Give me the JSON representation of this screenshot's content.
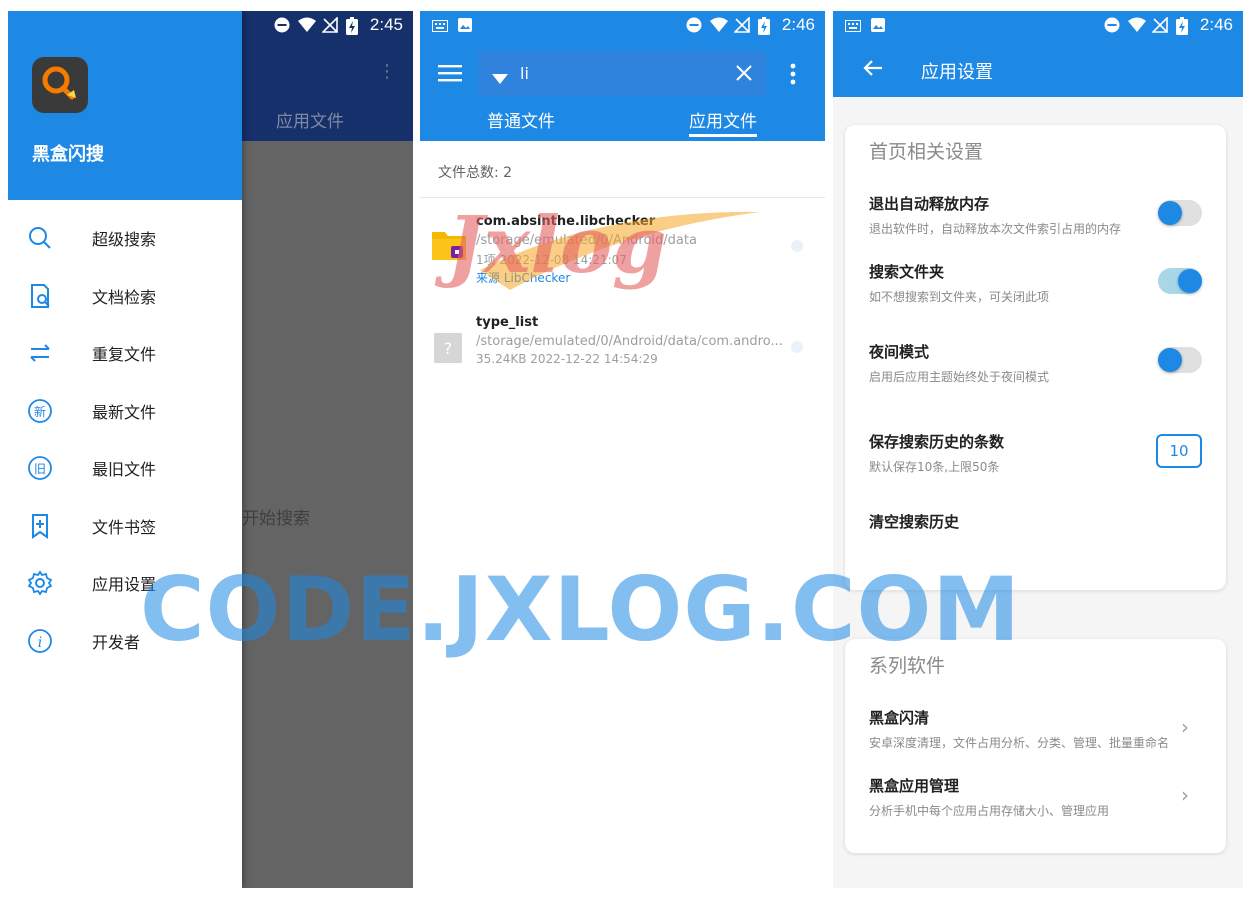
{
  "colors": {
    "primary": "#1e88e5",
    "dim": "#646464",
    "watermark_text": "#1e88e5",
    "watermark_logo": "#e46363",
    "swoosh": "#f5a623"
  },
  "status": {
    "time1": "2:45",
    "time2": "2:46",
    "time3": "2:46"
  },
  "drawer": {
    "app_name": "黑盒闪搜",
    "items": [
      {
        "label": "超级搜索",
        "icon": "search-icon"
      },
      {
        "label": "文档检索",
        "icon": "document-search-icon"
      },
      {
        "label": "重复文件",
        "icon": "repeat-icon"
      },
      {
        "label": "最新文件",
        "icon": "new-badge-icon"
      },
      {
        "label": "最旧文件",
        "icon": "old-badge-icon"
      },
      {
        "label": "文件书签",
        "icon": "bookmark-add-icon"
      },
      {
        "label": "应用设置",
        "icon": "gear-icon"
      },
      {
        "label": "开发者",
        "icon": "info-icon"
      }
    ],
    "behind_tab": "应用文件",
    "behind_hint": "开始搜索"
  },
  "files_screen": {
    "search_query": "li",
    "tabs": [
      "普通文件",
      "应用文件"
    ],
    "active_tab": 1,
    "count_label": "文件总数: 2",
    "files": [
      {
        "name": "com.absinthe.libchecker",
        "path": "/storage/emulated/0/Android/data",
        "meta": "1项  2022-12-08 14:21:07",
        "source": "来源  LibChecker",
        "icon": "folder-icon"
      },
      {
        "name": "type_list",
        "path": "/storage/emulated/0/Android/data/com.andro...",
        "meta": "35.24KB  2022-12-22 14:54:29",
        "source": "",
        "icon": "unknown-file-icon"
      }
    ]
  },
  "settings": {
    "title": "应用设置",
    "section1_title": "首页相关设置",
    "items": [
      {
        "title": "退出自动释放内存",
        "desc": "退出软件时，自动释放本次文件索引占用的内存",
        "toggle": false
      },
      {
        "title": "搜索文件夹",
        "desc": "如不想搜索到文件夹，可关闭此项",
        "toggle": true
      },
      {
        "title": "夜间模式",
        "desc": "启用后应用主题始终处于夜间模式",
        "toggle": false
      }
    ],
    "history_title": "保存搜索历史的条数",
    "history_desc": "默认保存10条,上限50条",
    "history_value": "10",
    "clear_history": "清空搜索历史",
    "section2_title": "系列软件",
    "apps": [
      {
        "title": "黑盒闪清",
        "desc": "安卓深度清理，文件占用分析、分类、管理、批量重命名"
      },
      {
        "title": "黑盒应用管理",
        "desc": "分析手机中每个应用占用存储大小、管理应用"
      }
    ]
  },
  "watermark": {
    "text": "CODE.JXLOG.COM",
    "logo": "Jxlog"
  }
}
